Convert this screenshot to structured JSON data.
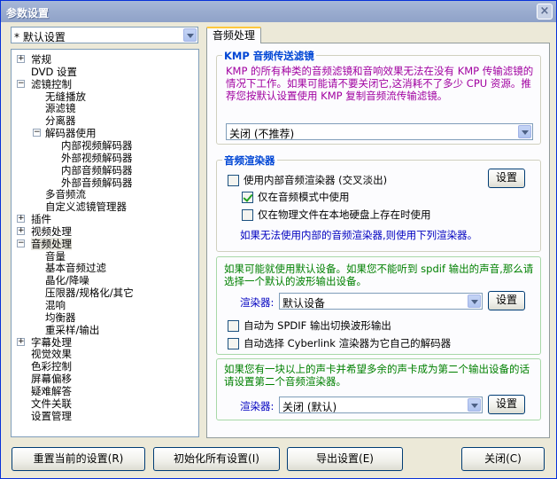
{
  "window": {
    "title": "参数设置",
    "close_glyph": "×"
  },
  "preset": {
    "value": "* 默认设置"
  },
  "tree": {
    "items": [
      {
        "label": "常规",
        "expander": "+"
      },
      {
        "label": "DVD 设置",
        "expander": ""
      },
      {
        "label": "滤镜控制",
        "expander": "−"
      },
      {
        "label": "无缝播放",
        "expander": ""
      },
      {
        "label": "源滤镜",
        "expander": ""
      },
      {
        "label": "分离器",
        "expander": ""
      },
      {
        "label": "解码器使用",
        "expander": "−"
      },
      {
        "label": "内部视频解码器",
        "expander": ""
      },
      {
        "label": "外部视频解码器",
        "expander": ""
      },
      {
        "label": "内部音频解码器",
        "expander": ""
      },
      {
        "label": "外部音频解码器",
        "expander": ""
      },
      {
        "label": "多音频流",
        "expander": ""
      },
      {
        "label": "自定义滤镜管理器",
        "expander": ""
      },
      {
        "label": "插件",
        "expander": "+"
      },
      {
        "label": "视频处理",
        "expander": "+"
      },
      {
        "label": "音频处理",
        "expander": "−"
      },
      {
        "label": "音量",
        "expander": ""
      },
      {
        "label": "基本音频过滤",
        "expander": ""
      },
      {
        "label": "晶化/降噪",
        "expander": ""
      },
      {
        "label": "压限器/规格化/其它",
        "expander": ""
      },
      {
        "label": "混响",
        "expander": ""
      },
      {
        "label": "均衡器",
        "expander": ""
      },
      {
        "label": "重采样/输出",
        "expander": ""
      },
      {
        "label": "字幕处理",
        "expander": "+"
      },
      {
        "label": "视觉效果",
        "expander": ""
      },
      {
        "label": "色彩控制",
        "expander": ""
      },
      {
        "label": "屏幕偏移",
        "expander": ""
      },
      {
        "label": "疑难解答",
        "expander": ""
      },
      {
        "label": "文件关联",
        "expander": ""
      },
      {
        "label": "设置管理",
        "expander": ""
      }
    ]
  },
  "tab": {
    "label": "音频处理"
  },
  "kmp_group": {
    "title": "KMP 音频传送滤镜",
    "description": "KMP 的所有种类的音频滤镜和音响效果无法在没有 KMP 传输滤镜的情况下工作。如果可能请不要关闭它,这消耗不了多少 CPU 资源。推荐您按默认设置使用 KMP 复制音频流传输滤镜。",
    "combo_value": "关闭 (不推荐)"
  },
  "renderer_group": {
    "title": "音频渲染器",
    "use_internal_label": "使用内部音频渲染器 (交叉淡出)",
    "settings_label": "设置",
    "audio_mode_only_label": "仅在音频模式中使用",
    "local_file_only_label": "仅在物理文件在本地硬盘上存在时使用",
    "fallback_note": "如果无法使用内部的音频渲染器,则使用下列渲染器。"
  },
  "default_device": {
    "note": "如果可能就使用默认设备。如果您不能听到 spdif 输出的声音,那么请选择一个默认的波形输出设备。",
    "renderer_label": "渲染器:",
    "renderer_value": "默认设备",
    "settings_label": "设置",
    "spdif_label": "自动为 SPDIF 输出切换波形输出",
    "cyberlink_label": "自动选择 Cyberlink 渲染器为它自己的解码器"
  },
  "second_device": {
    "note": "如果您有一块以上的声卡并希望多余的声卡成为第二个输出设备的话请设置第二个音频渲染器。",
    "renderer_label": "渲染器:",
    "renderer_value": "关闭 (默认)",
    "settings_label": "设置"
  },
  "buttons": {
    "reset_current": "重置当前的设置(R)",
    "init_all": "初始化所有设置(I)",
    "export": "导出设置(E)",
    "close": "关闭(C)"
  }
}
